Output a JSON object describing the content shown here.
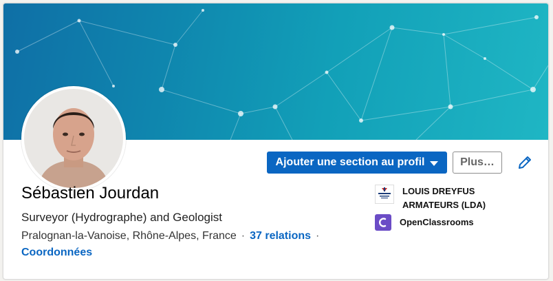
{
  "profile": {
    "name": "Sébastien Jourdan",
    "headline": "Surveyor (Hydrographe) and Geologist",
    "location": "Pralognan-la-Vanoise, Rhône-Alpes, France",
    "separator": "·",
    "relations": "37 relations",
    "contact_link": "Coordonnées"
  },
  "actions": {
    "add_section": "Ajouter une section au profil",
    "more": "Plus…",
    "edit_icon": "pencil-icon"
  },
  "organizations": [
    {
      "name": "LOUIS DREYFUS ARMATEURS (LDA)",
      "logo_icon": "louis-dreyfus-logo-icon"
    },
    {
      "name": "OpenClassrooms",
      "logo_icon": "openclassrooms-logo-icon"
    }
  ],
  "colors": {
    "primary_blue": "#0a66c2",
    "banner_teal": "#12a0b8",
    "openclassrooms_purple": "#6b4cc6"
  }
}
